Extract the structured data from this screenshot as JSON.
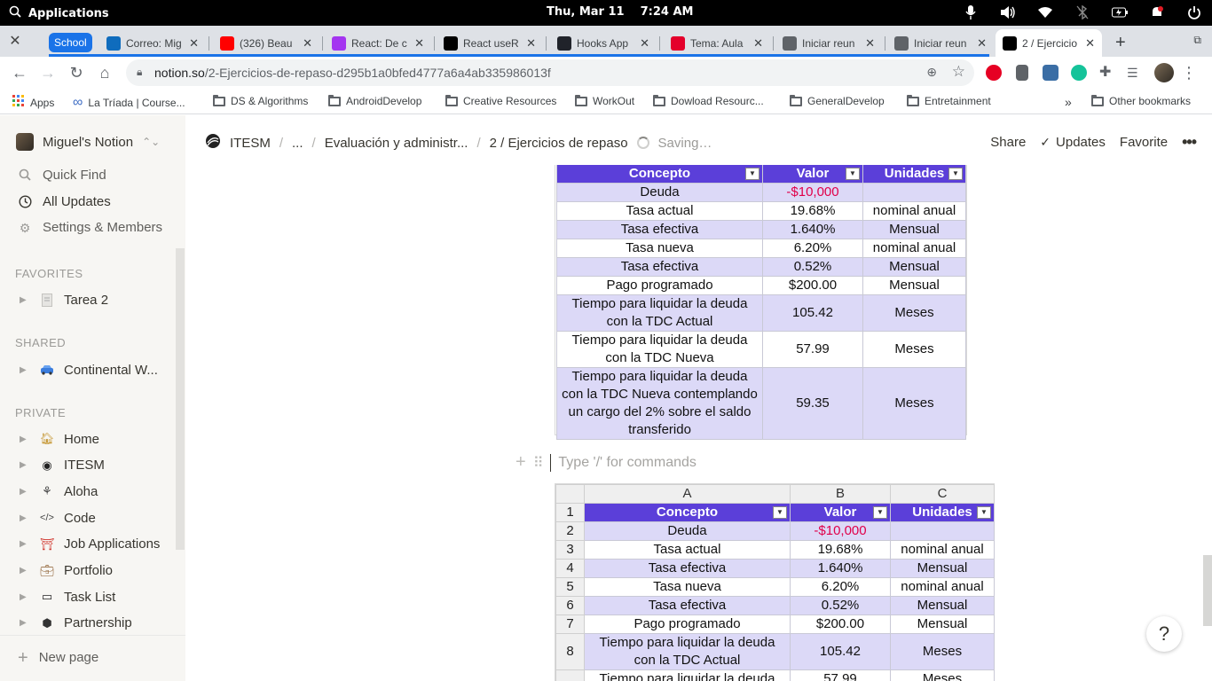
{
  "system": {
    "apps_label": "Applications",
    "date": "Thu, Mar 11",
    "time": "7:24 AM"
  },
  "tabs": {
    "group_label": "School",
    "items": [
      {
        "label": "Correo: Mig",
        "icon": "outlook-icon",
        "color": "#0f6cbd"
      },
      {
        "label": "(326) Beau",
        "icon": "youtube-icon",
        "color": "#ff0000"
      },
      {
        "label": "React: De c",
        "icon": "udemy-icon",
        "color": "#a435f0"
      },
      {
        "label": "React useR",
        "icon": "medium-icon",
        "color": "#000000"
      },
      {
        "label": "Hooks App",
        "icon": "react-icon",
        "color": "#20232a"
      },
      {
        "label": "Tema: Aula",
        "icon": "blackboard-icon",
        "color": "#e4002b"
      },
      {
        "label": "Iniciar reun",
        "icon": "globe-icon",
        "color": "#5f6368"
      },
      {
        "label": "Iniciar reun",
        "icon": "globe-icon",
        "color": "#5f6368"
      },
      {
        "label": "2 / Ejercicio",
        "icon": "notion-icon",
        "color": "#000000"
      }
    ]
  },
  "address": {
    "host": "notion.so",
    "path": "/2-Ejercicios-de-repaso-d295b1a0bfed4777a6a4ab335986013f"
  },
  "bookmarks": {
    "apps_label": "Apps",
    "items": [
      "La Tríada | Course...",
      "DS & Algorithms",
      "AndroidDevelop",
      "Creative Resources",
      "WorkOut",
      "Dowload Resourc...",
      "GeneralDevelop",
      "Entretainment"
    ],
    "more": "»",
    "other": "Other bookmarks"
  },
  "sidebar": {
    "workspace": "Miguel's Notion",
    "quick_find": "Quick Find",
    "all_updates": "All Updates",
    "settings": "Settings & Members",
    "favorites_head": "FAVORITES",
    "favorites": [
      {
        "label": "Tarea 2",
        "icon": "page-icon"
      }
    ],
    "shared_head": "SHARED",
    "shared": [
      {
        "label": "Continental W...",
        "icon": "car-icon"
      }
    ],
    "private_head": "PRIVATE",
    "private": [
      {
        "label": "Home",
        "icon": "house-icon"
      },
      {
        "label": "ITESM",
        "icon": "itesm-logo-icon"
      },
      {
        "label": "Aloha",
        "icon": "aloha-icon"
      },
      {
        "label": "Code",
        "icon": "code-icon"
      },
      {
        "label": "Job Applications",
        "icon": "crane-icon"
      },
      {
        "label": "Portfolio",
        "icon": "briefcase-icon"
      },
      {
        "label": "Task List",
        "icon": "folder-icon"
      },
      {
        "label": "Partnership",
        "icon": "cube-icon"
      }
    ],
    "new_page": "New page"
  },
  "header": {
    "crumbs": [
      "ITESM",
      "...",
      "Evaluación y administr...",
      "2 / Ejercicios de repaso"
    ],
    "saving": "Saving…",
    "share": "Share",
    "updates": "Updates",
    "favorite": "Favorite"
  },
  "editor": {
    "placeholder": "Type '/' for commands"
  },
  "table_top": {
    "headers": [
      "Concepto",
      "Valor",
      "Unidades"
    ],
    "rows": [
      [
        "Deuda",
        "-$10,000",
        ""
      ],
      [
        "Tasa actual",
        "19.68%",
        "nominal anual"
      ],
      [
        "Tasa efectiva",
        "1.640%",
        "Mensual"
      ],
      [
        "Tasa nueva",
        "6.20%",
        "nominal anual"
      ],
      [
        "Tasa efectiva",
        "0.52%",
        "Mensual"
      ],
      [
        "Pago programado",
        "$200.00",
        "Mensual"
      ],
      [
        "Tiempo para liquidar la deuda con la TDC Actual",
        "105.42",
        "Meses"
      ],
      [
        "Tiempo para liquidar la deuda con la TDC Nueva",
        "57.99",
        "Meses"
      ],
      [
        "Tiempo para liquidar la deuda con la TDC Nueva contemplando un cargo del 2% sobre el saldo transferido",
        "59.35",
        "Meses"
      ]
    ]
  },
  "table_bottom": {
    "col_letters": [
      "A",
      "B",
      "C"
    ],
    "headers": [
      "Concepto",
      "Valor",
      "Unidades"
    ],
    "row_numbers": [
      "1",
      "2",
      "3",
      "4",
      "5",
      "6",
      "7",
      "8"
    ],
    "rows": [
      [
        "Deuda",
        "-$10,000",
        ""
      ],
      [
        "Tasa actual",
        "19.68%",
        "nominal anual"
      ],
      [
        "Tasa efectiva",
        "1.640%",
        "Mensual"
      ],
      [
        "Tasa nueva",
        "6.20%",
        "nominal anual"
      ],
      [
        "Tasa efectiva",
        "0.52%",
        "Mensual"
      ],
      [
        "Pago programado",
        "$200.00",
        "Mensual"
      ],
      [
        "Tiempo para liquidar la deuda con la TDC Actual",
        "105.42",
        "Meses"
      ]
    ],
    "partial_row": [
      "Tiempo para liquidar la deuda",
      "57.99",
      "Meses"
    ]
  },
  "help": "?",
  "colors": {
    "header_purple": "#5b3fd9",
    "row_lavender": "#dcd9f7",
    "negative_red": "#e0004a",
    "tab_group_blue": "#1a73e8"
  }
}
